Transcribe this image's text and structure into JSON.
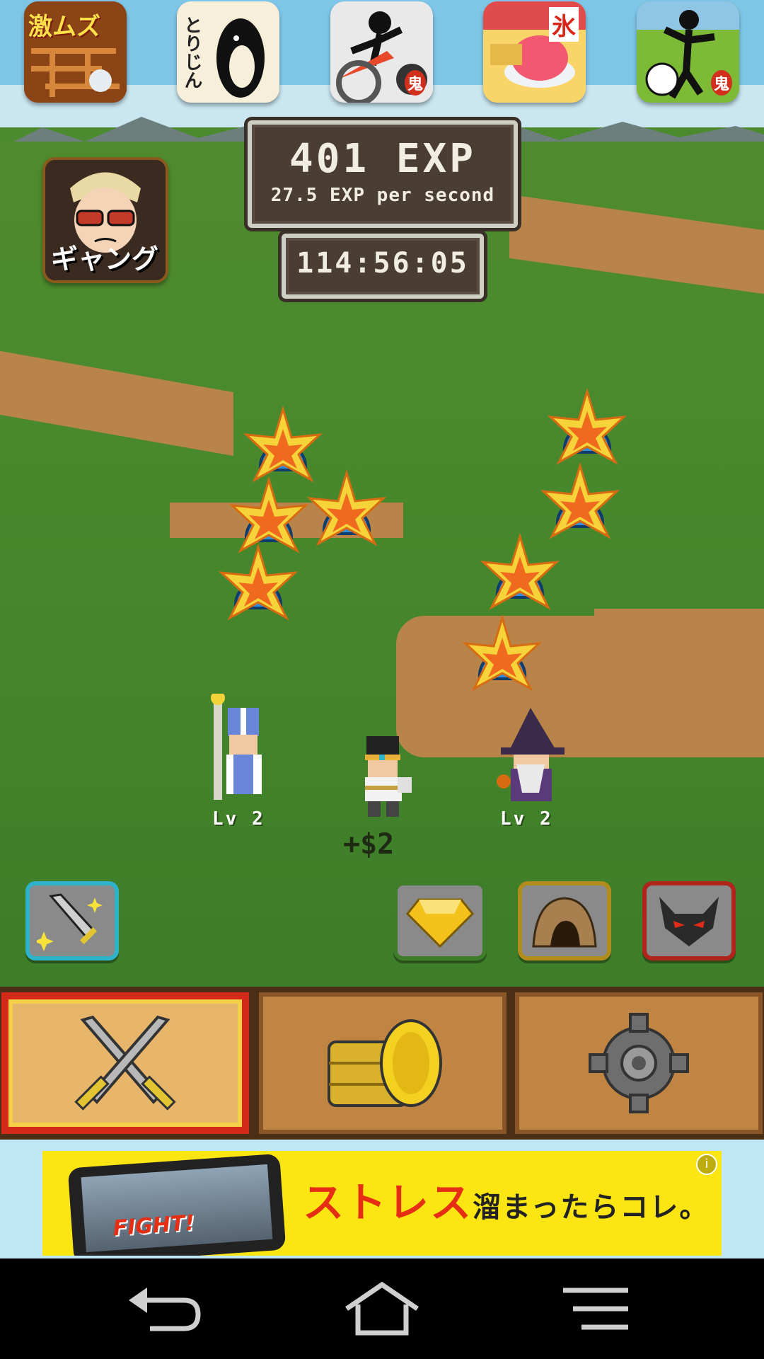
{
  "hud": {
    "exp_total": "401 EXP",
    "exp_rate": "27.5 EXP per second",
    "timer": "114:56:05"
  },
  "promo_apps": [
    {
      "icon": "maze-game-icon",
      "label": "激ムズ"
    },
    {
      "icon": "penguin-icon",
      "label": "とりじん"
    },
    {
      "icon": "stickman-cannon-icon",
      "label": "鬼"
    },
    {
      "icon": "shaved-ice-icon",
      "label": "氷"
    },
    {
      "icon": "soccer-stickman-icon",
      "label": "鬼"
    }
  ],
  "side_promo": {
    "icon": "gang-game-icon",
    "label": "ギャング"
  },
  "party": [
    {
      "name": "priest",
      "level_label": "Lv 2"
    },
    {
      "name": "hero",
      "gain_label": "+$2"
    },
    {
      "name": "wizard",
      "level_label": "Lv 2"
    }
  ],
  "action_buttons": [
    {
      "icon": "sword-upgrade-icon"
    },
    {
      "icon": "gem-icon"
    },
    {
      "icon": "cave-icon"
    },
    {
      "icon": "demon-icon"
    }
  ],
  "tabs": [
    {
      "icon": "crossed-swords-icon",
      "active": true
    },
    {
      "icon": "gold-coins-icon",
      "active": false
    },
    {
      "icon": "settings-gear-icon",
      "active": false
    }
  ],
  "ad": {
    "headline": "ストレス",
    "tagline": "溜まったらコレ。",
    "game_text": "FIGHT!",
    "info": "i"
  },
  "nav": [
    "back-icon",
    "home-icon",
    "menu-icon"
  ],
  "colors": {
    "board": "#4a3d33",
    "grass": "#4a8a2e",
    "dirt": "#b9844a",
    "active_tab_border": "#d32a17",
    "ad_bg": "#fbe613"
  }
}
